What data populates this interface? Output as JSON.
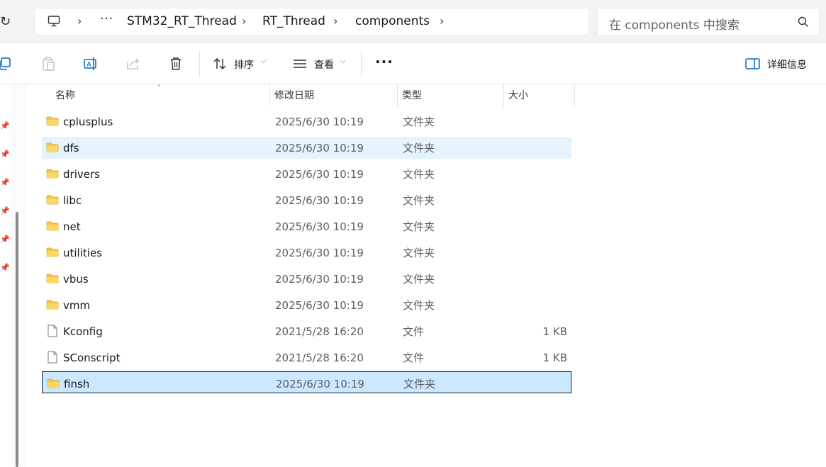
{
  "address_bar": {
    "breadcrumbs": [
      "STM32_RT_Thread",
      "RT_Thread",
      "components"
    ],
    "ellipsis": "···",
    "separator": "›"
  },
  "search": {
    "placeholder": "在 components 中搜索"
  },
  "command_bar": {
    "sort_label": "排序",
    "view_label": "查看",
    "more_label": "···",
    "details_label": "详细信息"
  },
  "columns": {
    "name": "名称",
    "date": "修改日期",
    "type": "类型",
    "size": "大小"
  },
  "files": [
    {
      "name": "cplusplus",
      "date": "2025/6/30 10:19",
      "type": "文件夹",
      "size": "",
      "kind": "folder-icon"
    },
    {
      "name": "dfs",
      "date": "2025/6/30 10:19",
      "type": "文件夹",
      "size": "",
      "kind": "folder-icon"
    },
    {
      "name": "drivers",
      "date": "2025/6/30 10:19",
      "type": "文件夹",
      "size": "",
      "kind": "folder-icon"
    },
    {
      "name": "libc",
      "date": "2025/6/30 10:19",
      "type": "文件夹",
      "size": "",
      "kind": "folder-icon"
    },
    {
      "name": "net",
      "date": "2025/6/30 10:19",
      "type": "文件夹",
      "size": "",
      "kind": "folder-icon"
    },
    {
      "name": "utilities",
      "date": "2025/6/30 10:19",
      "type": "文件夹",
      "size": "",
      "kind": "folder-icon"
    },
    {
      "name": "vbus",
      "date": "2025/6/30 10:19",
      "type": "文件夹",
      "size": "",
      "kind": "folder-icon"
    },
    {
      "name": "vmm",
      "date": "2025/6/30 10:19",
      "type": "文件夹",
      "size": "",
      "kind": "folder-icon"
    },
    {
      "name": "Kconfig",
      "date": "2021/5/28 16:20",
      "type": "文件",
      "size": "1 KB",
      "kind": "file-icon"
    },
    {
      "name": "SConscript",
      "date": "2021/5/28 16:20",
      "type": "文件",
      "size": "1 KB",
      "kind": "file-icon"
    },
    {
      "name": "finsh",
      "date": "2025/6/30 10:19",
      "type": "文件夹",
      "size": "",
      "kind": "folder-icon"
    }
  ],
  "hover_index": 1,
  "selected_index": 10,
  "colors": {
    "hover": "#e5f3ff",
    "selected": "#cce8ff",
    "folder": "#f4c542"
  }
}
